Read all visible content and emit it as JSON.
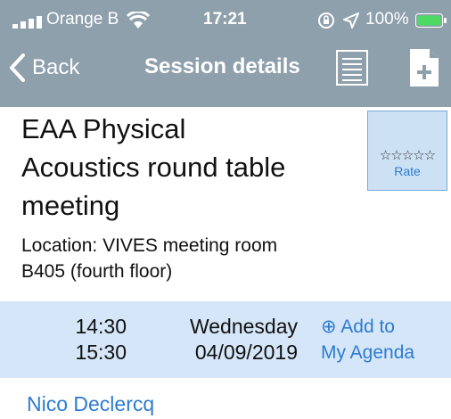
{
  "status_bar": {
    "carrier": "Orange B",
    "time": "17:21",
    "battery": "100%"
  },
  "nav": {
    "back_label": "Back",
    "title": "Session details"
  },
  "session": {
    "title_lines": [
      "EAA Physical",
      "Acoustics round table",
      "meeting"
    ],
    "location_lines": [
      "Location: VIVES meeting room",
      "B405 (fourth floor)"
    ]
  },
  "rating": {
    "stars": "☆☆☆☆☆",
    "label": "Rate"
  },
  "schedule": {
    "start_time": "14:30",
    "end_time": "15:30",
    "weekday": "Wednesday",
    "date": "04/09/2019",
    "agenda_line1": "⊕ Add to",
    "agenda_line2": "My Agenda"
  },
  "speakers": [
    "Nico Declercq"
  ],
  "colors": {
    "header": "#8fa0ad",
    "link": "#2e7bd0",
    "band": "#d4e6f8",
    "battery": "#4cd964"
  }
}
